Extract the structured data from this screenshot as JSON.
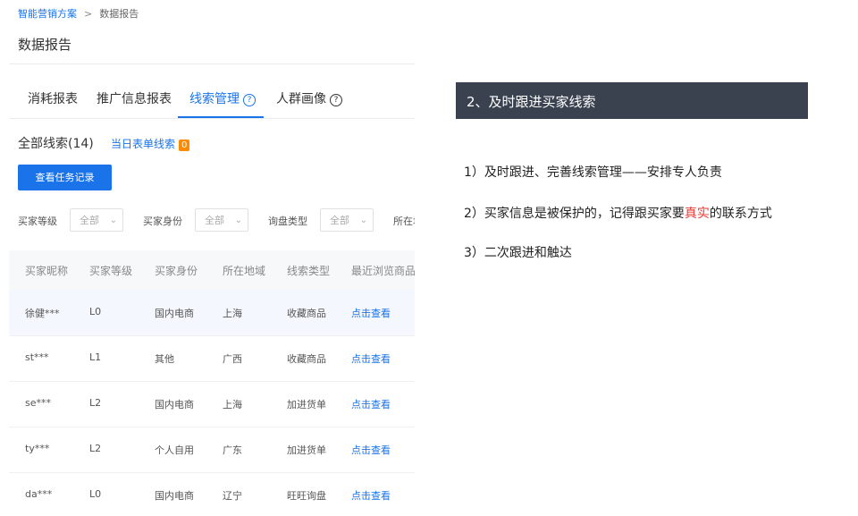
{
  "breadcrumb": {
    "root": "智能营销方案",
    "separator": ">",
    "current": "数据报告"
  },
  "page_title": "数据报告",
  "tabs": [
    {
      "label": "消耗报表"
    },
    {
      "label": "推广信息报表"
    },
    {
      "label": "线索管理",
      "help": "?"
    },
    {
      "label": "人群画像",
      "help": "?"
    }
  ],
  "leads": {
    "all": "全部线索(14)",
    "today": "当日表单线索",
    "today_count": "0"
  },
  "view_tasks_button": "查看任务记录",
  "filters": [
    {
      "label": "买家等级",
      "value": "全部"
    },
    {
      "label": "买家身份",
      "value": "全部"
    },
    {
      "label": "询盘类型",
      "value": "全部"
    },
    {
      "label": "所在地"
    }
  ],
  "table": {
    "headers": [
      "买家昵称",
      "买家等级",
      "买家身份",
      "所在地域",
      "线索类型",
      "最近浏览商品"
    ],
    "rows": [
      [
        "徐健***",
        "L0",
        "国内电商",
        "上海",
        "收藏商品",
        "点击查看"
      ],
      [
        "st***",
        "L1",
        "其他",
        "广西",
        "收藏商品",
        "点击查看"
      ],
      [
        "se***",
        "L2",
        "国内电商",
        "上海",
        "加进货单",
        "点击查看"
      ],
      [
        "ty***",
        "L2",
        "个人自用",
        "广东",
        "加进货单",
        "点击查看"
      ],
      [
        "da***",
        "L0",
        "国内电商",
        "辽宁",
        "旺旺询盘",
        "点击查看"
      ]
    ]
  },
  "slide": {
    "heading": "2、及时跟进买家线索",
    "points": [
      {
        "prefix": "1）及时跟进、完善线索管理——安排专人负责"
      },
      {
        "prefix": "2）买家信息是被保护的，记得跟买家要",
        "highlight": "真实",
        "suffix": "的联系方式"
      },
      {
        "prefix": "3）二次跟进和触达"
      }
    ]
  },
  "colors": {
    "link": "#1a73e8",
    "primary": "#1a73e8",
    "badge": "#ff8a00",
    "banner": "#3a4250",
    "highlight": "#e53935"
  }
}
